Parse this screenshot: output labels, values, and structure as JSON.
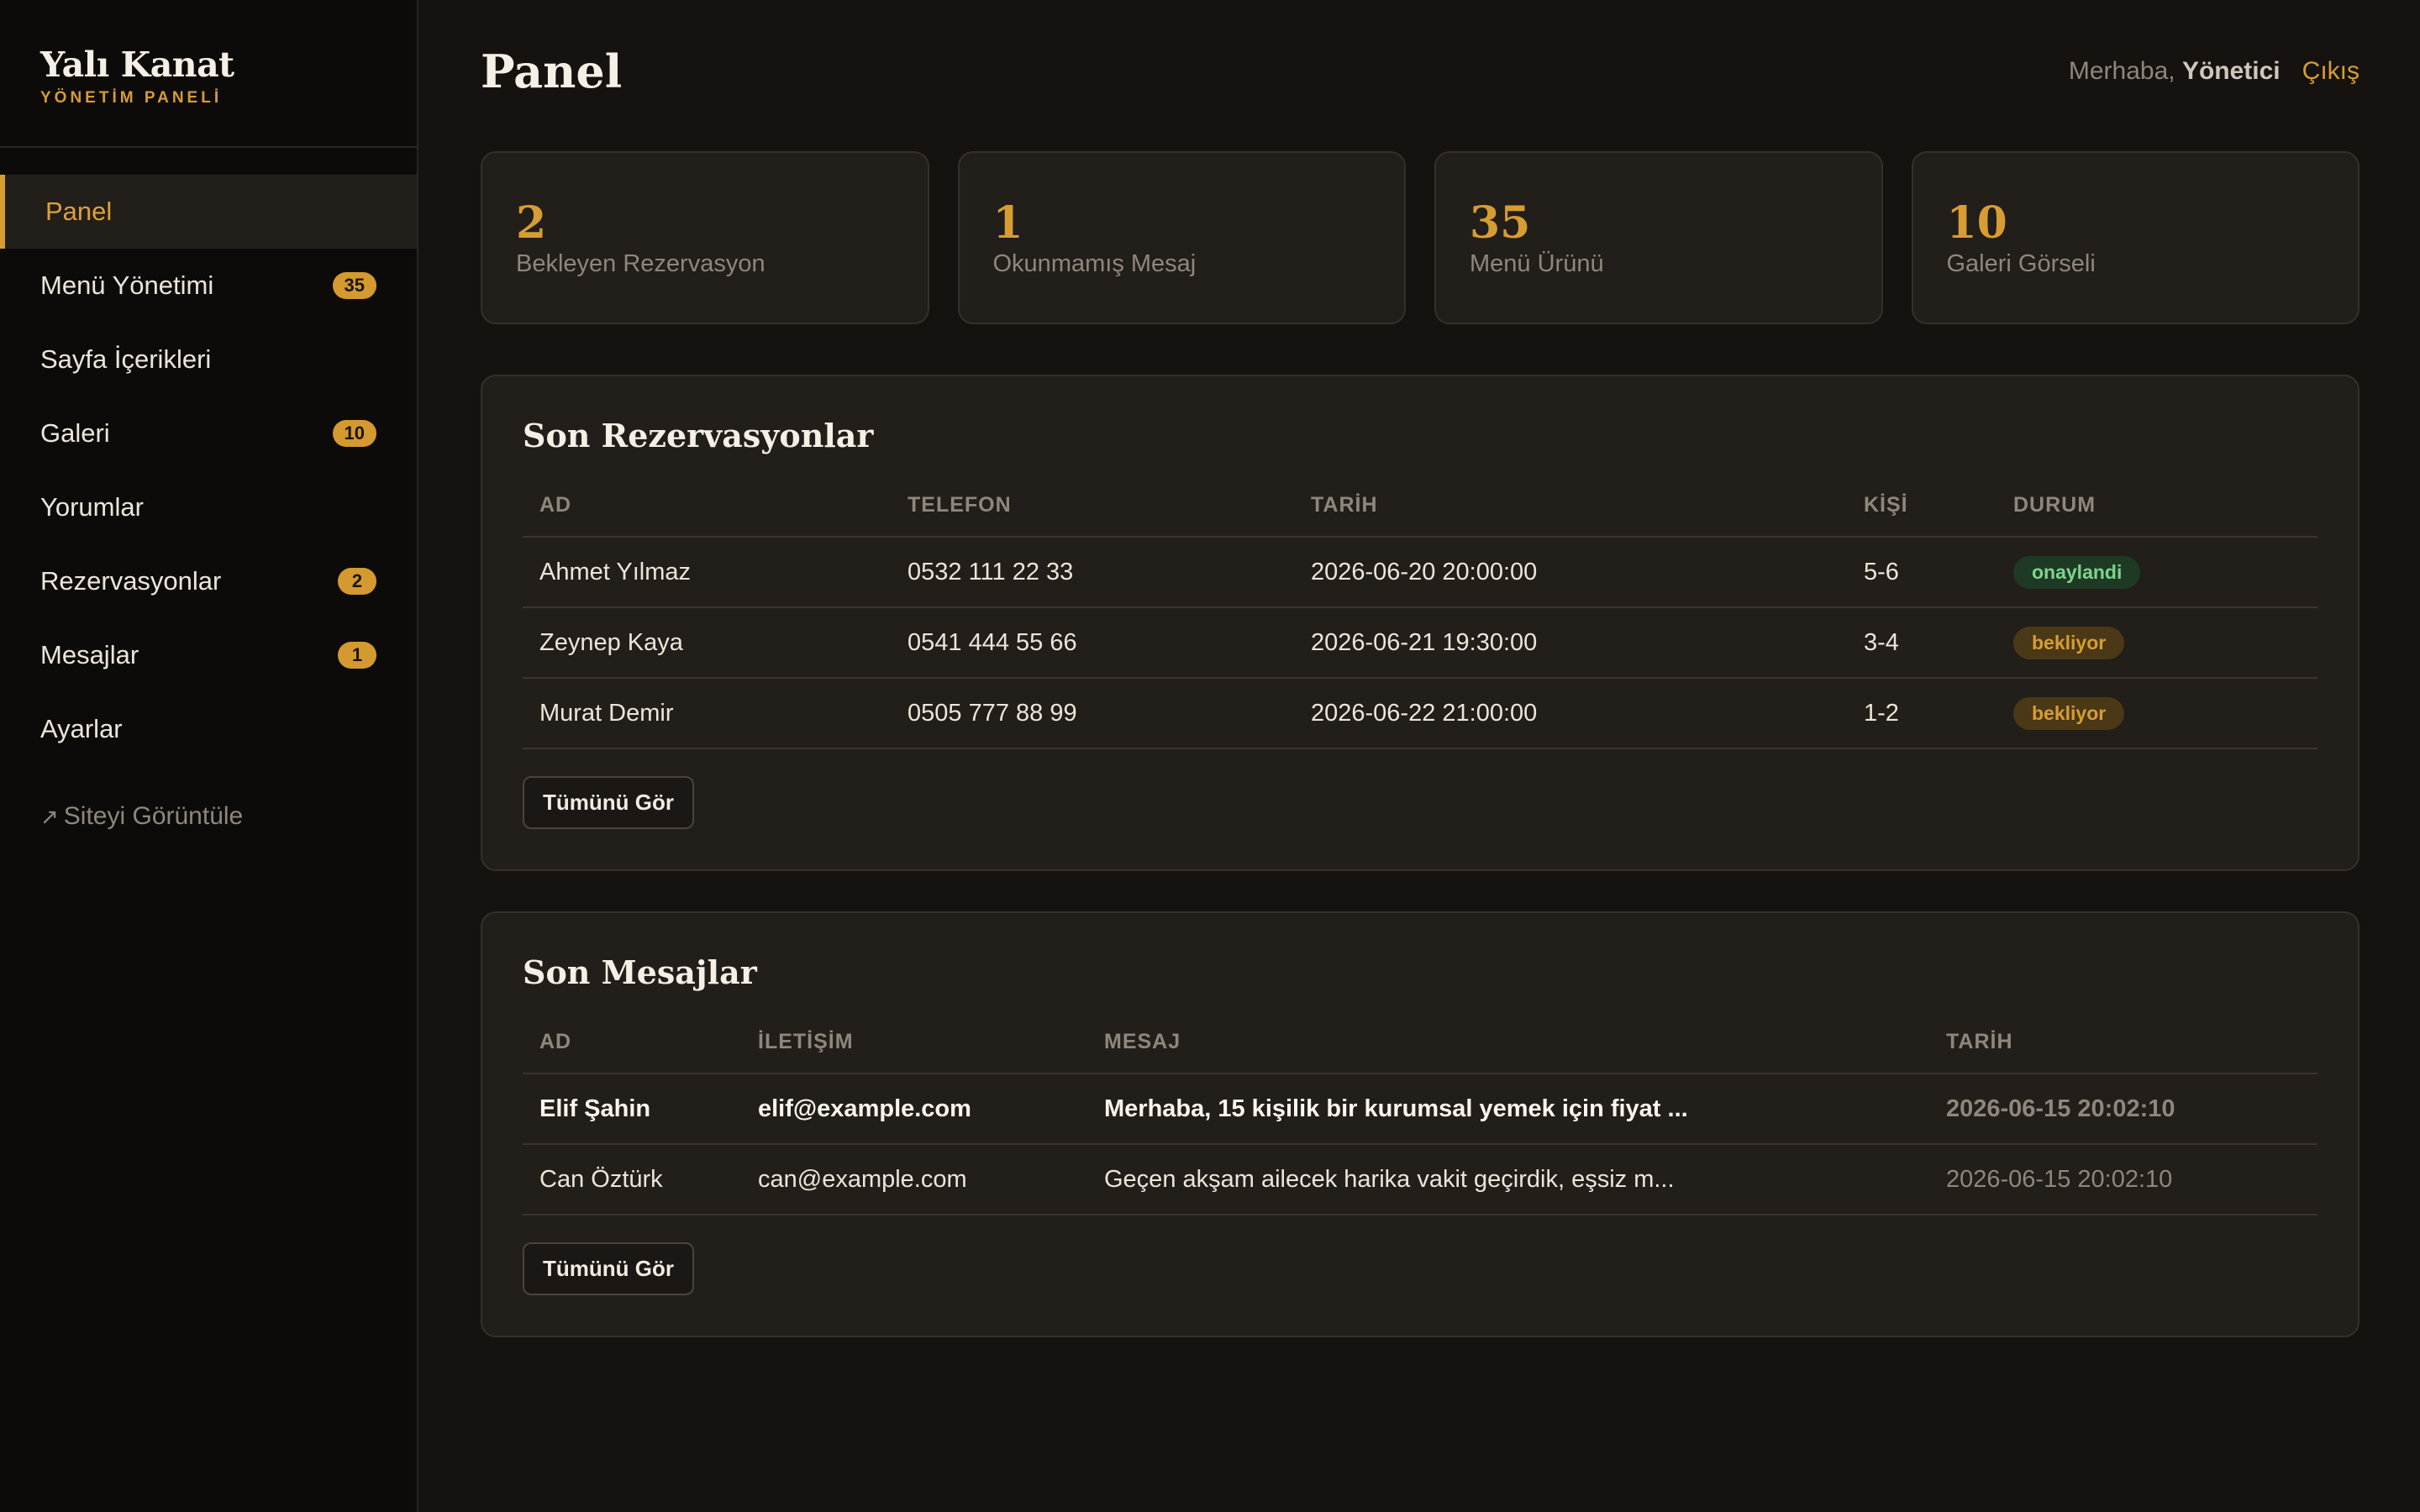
{
  "brand": {
    "name": "Yalı Kanat",
    "subtitle": "YÖNETİM PANELİ"
  },
  "sidebar": {
    "items": [
      {
        "label": "Panel",
        "badge": null
      },
      {
        "label": "Menü Yönetimi",
        "badge": "35"
      },
      {
        "label": "Sayfa İçerikleri",
        "badge": null
      },
      {
        "label": "Galeri",
        "badge": "10"
      },
      {
        "label": "Yorumlar",
        "badge": null
      },
      {
        "label": "Rezervasyonlar",
        "badge": "2"
      },
      {
        "label": "Mesajlar",
        "badge": "1"
      },
      {
        "label": "Ayarlar",
        "badge": null
      }
    ],
    "site_link": "Siteyi Görüntüle",
    "site_link_icon": "↗"
  },
  "header": {
    "title": "Panel",
    "greeting": "Merhaba,",
    "user": "Yönetici",
    "logout": "Çıkış"
  },
  "stats": [
    {
      "value": "2",
      "label": "Bekleyen Rezervasyon"
    },
    {
      "value": "1",
      "label": "Okunmamış Mesaj"
    },
    {
      "value": "35",
      "label": "Menü Ürünü"
    },
    {
      "value": "10",
      "label": "Galeri Görseli"
    }
  ],
  "reservations": {
    "title": "Son Rezervasyonlar",
    "columns": [
      "AD",
      "TELEFON",
      "TARİH",
      "KİŞİ",
      "DURUM"
    ],
    "rows": [
      {
        "name": "Ahmet Yılmaz",
        "phone": "0532 111 22 33",
        "date": "2026-06-20 20:00:00",
        "people": "5-6",
        "status": "onaylandi"
      },
      {
        "name": "Zeynep Kaya",
        "phone": "0541 444 55 66",
        "date": "2026-06-21 19:30:00",
        "people": "3-4",
        "status": "bekliyor"
      },
      {
        "name": "Murat Demir",
        "phone": "0505 777 88 99",
        "date": "2026-06-22 21:00:00",
        "people": "1-2",
        "status": "bekliyor"
      }
    ],
    "button": "Tümünü Gör"
  },
  "messages": {
    "title": "Son Mesajlar",
    "columns": [
      "AD",
      "İLETİŞİM",
      "MESAJ",
      "TARİH"
    ],
    "rows": [
      {
        "name": "Elif Şahin",
        "contact": "elif@example.com",
        "message": "Merhaba, 15 kişilik bir kurumsal yemek için fiyat ...",
        "date": "2026-06-15 20:02:10",
        "unread": true
      },
      {
        "name": "Can Öztürk",
        "contact": "can@example.com",
        "message": "Geçen akşam ailecek harika vakit geçirdik, eşsiz m...",
        "date": "2026-06-15 20:02:10",
        "unread": false
      }
    ],
    "button": "Tümünü Gör"
  },
  "colors": {
    "accent": "#d79d33",
    "approved": "#7fd38c",
    "pending": "#d79d33"
  }
}
